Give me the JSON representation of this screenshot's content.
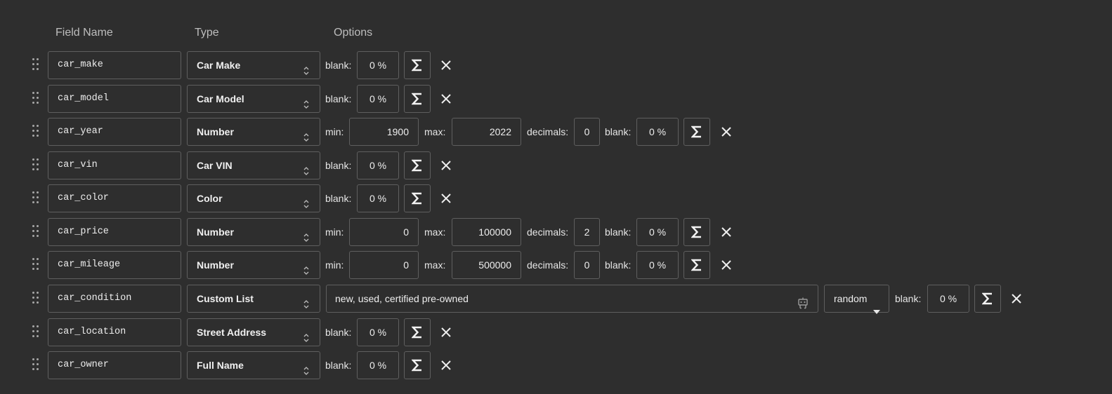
{
  "headers": {
    "field_name": "Field Name",
    "type": "Type",
    "options": "Options"
  },
  "labels": {
    "blank": "blank:",
    "min": "min:",
    "max": "max:",
    "decimals": "decimals:"
  },
  "icons": {
    "drag": "drag-handle-icon",
    "select": "updown-chevron-icon",
    "sigma": "sigma-icon",
    "delete": "close-icon",
    "ai": "robot-icon",
    "dropdown": "caret-down-icon"
  },
  "rows": [
    {
      "name": "car_make",
      "type": "Car Make",
      "blank": "0 %"
    },
    {
      "name": "car_model",
      "type": "Car Model",
      "blank": "0 %"
    },
    {
      "name": "car_year",
      "type": "Number",
      "min": "1900",
      "max": "2022",
      "decimals": "0",
      "blank": "0 %"
    },
    {
      "name": "car_vin",
      "type": "Car VIN",
      "blank": "0 %"
    },
    {
      "name": "car_color",
      "type": "Color",
      "blank": "0 %"
    },
    {
      "name": "car_price",
      "type": "Number",
      "min": "0",
      "max": "100000",
      "decimals": "2",
      "blank": "0 %"
    },
    {
      "name": "car_mileage",
      "type": "Number",
      "min": "0",
      "max": "500000",
      "decimals": "0",
      "blank": "0 %"
    },
    {
      "name": "car_condition",
      "type": "Custom List",
      "values": "new, used, certified pre-owned",
      "mode": "random",
      "blank": "0 %"
    },
    {
      "name": "car_location",
      "type": "Street Address",
      "blank": "0 %"
    },
    {
      "name": "car_owner",
      "type": "Full Name",
      "blank": "0 %"
    }
  ]
}
